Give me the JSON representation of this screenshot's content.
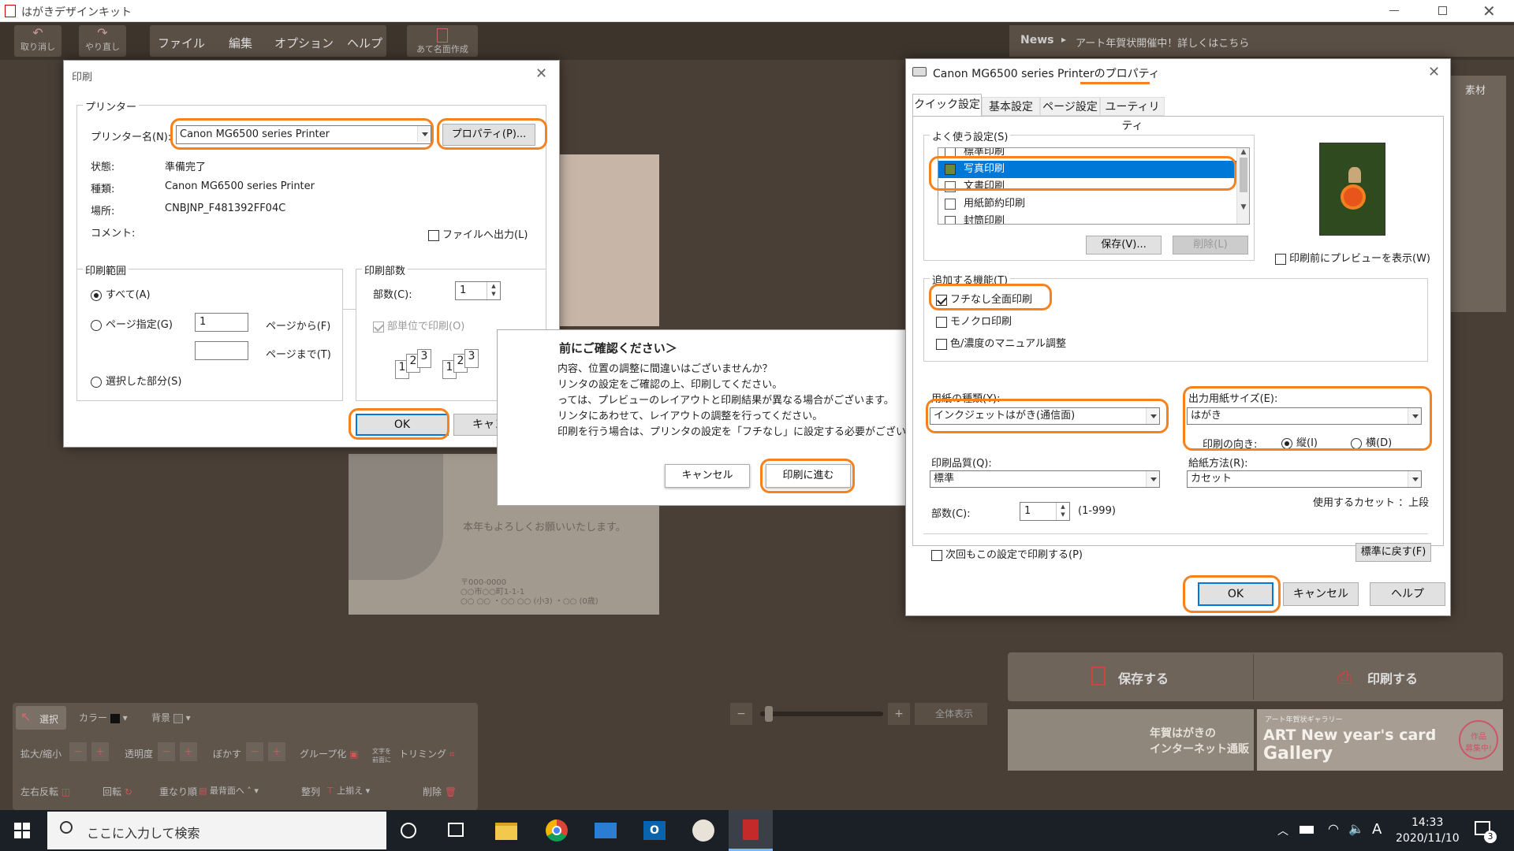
{
  "app": {
    "title": "はがきデザインキット",
    "news_label": "News",
    "news_text": "アート年賀状開催中！詳しくはこちら",
    "material_tab": "素材"
  },
  "toolbar": {
    "undo": "取り消し",
    "redo": "やり直し",
    "file": "ファイル",
    "edit": "編集",
    "option": "オプション",
    "help": "ヘルプ",
    "address": "あて名面作成"
  },
  "print_dialog": {
    "title": "印刷",
    "printer_group": "プリンター",
    "printer_name_label": "プリンター名(N):",
    "printer_name_value": "Canon MG6500 series Printer",
    "properties_button": "プロパティ(P)...",
    "status_label": "状態:",
    "status_value": "準備完了",
    "type_label": "種類:",
    "type_value": "Canon MG6500 series Printer",
    "location_label": "場所:",
    "location_value": "CNBJNP_F481392FF04C",
    "comment_label": "コメント:",
    "print_to_file": "ファイルへ出力(L)",
    "range_group": "印刷範囲",
    "range_all": "すべて(A)",
    "range_pages": "ページ指定(G)",
    "range_from_value": "1",
    "range_from_suffix": "ページから(F)",
    "range_to_value": "",
    "range_to_suffix": "ページまで(T)",
    "range_selection": "選択した部分(S)",
    "copies_group": "印刷部数",
    "copies_label": "部数(C):",
    "copies_value": "1",
    "collate": "部単位で印刷(O)",
    "ok": "OK",
    "cancel": "キャンセル"
  },
  "confirm_dialog": {
    "title": "前にご確認ください＞",
    "lines": [
      "内容、位置の調整に間違いはございませんか？",
      "リンタの設定をご確認の上、印刷してください。",
      "っては、プレビューのレイアウトと印刷結果が異なる場合がございます。",
      "リンタにあわせて、レイアウトの調整を行ってください。",
      "印刷を行う場合は、プリンタの設定を「フチなし」に設定する必要がございます"
    ],
    "cancel": "キャンセル",
    "proceed": "印刷に進む"
  },
  "card": {
    "greeting": "本年もよろしくお願いいたします。",
    "address1": "〒000-0000",
    "address2": "○○市○○町1-1-1",
    "address3": "○○ ○○ ・○○ ○○ (小3) ・○○ (0歳)"
  },
  "props_dialog": {
    "title": "Canon MG6500 series Printerのプロパティ",
    "tabs": [
      "クイック設定",
      "基本設定",
      "ページ設定",
      "ユーティリティ"
    ],
    "favorites_label": "よく使う設定(S)",
    "favorites": [
      "標準印刷",
      "写真印刷",
      "文書印刷",
      "用紙節約印刷",
      "封筒印刷"
    ],
    "save_button": "保存(V)...",
    "delete_button": "削除(L)",
    "preview_checkbox": "印刷前にプレビューを表示(W)",
    "features_label": "追加する機能(T)",
    "features": [
      {
        "label": "フチなし全面印刷",
        "checked": true
      },
      {
        "label": "モノクロ印刷",
        "checked": false
      },
      {
        "label": "色/濃度のマニュアル調整",
        "checked": false
      }
    ],
    "media_label": "用紙の種類(Y):",
    "media_value": "インクジェットはがき(通信面)",
    "output_size_label": "出力用紙サイズ(E):",
    "output_size_value": "はがき",
    "orientation_label": "印刷の向き:",
    "portrait": "縦(I)",
    "landscape": "横(D)",
    "quality_label": "印刷品質(Q):",
    "quality_value": "標準",
    "feed_label": "給紙方法(R):",
    "feed_value": "カセット",
    "cassette_note": "使用するカセット ：上段",
    "copies_label": "部数(C):",
    "copies_value": "1",
    "copies_range": "(1-999)",
    "always_print": "次回もこの設定で印刷する(P)",
    "defaults_button": "標準に戻す(F)",
    "ok": "OK",
    "cancel": "キャンセル",
    "help": "ヘルプ"
  },
  "bottom_panel": {
    "select": "選択",
    "color": "カラー",
    "background": "背景",
    "zoom": "拡大/縮小",
    "opacity": "透明度",
    "blur": "ぼかす",
    "group": "グループ化",
    "text_label": "文字を前面に",
    "trim": "トリミング",
    "flip": "左右反転",
    "rotate": "回転",
    "order": "重なり順",
    "front": "最背面へ",
    "align": "整列",
    "top_align": "上揃え",
    "delete": "削除",
    "fit": "全体表示"
  },
  "actions": {
    "save": "保存する",
    "print": "印刷する",
    "banner_left_1": "年賀はがきの",
    "banner_left_2": "インターネット通販",
    "banner_gallery_small": "アート年賀状ギャラリー",
    "banner_right_1": "ART New year's card",
    "banner_right_2": "Gallery",
    "banner_badge_1": "作品",
    "banner_badge_2": "募集中!"
  },
  "taskbar": {
    "search_placeholder": "ここに入力して検索",
    "time": "14:33",
    "date": "2020/11/10",
    "ime": "A",
    "notifications": "3"
  }
}
